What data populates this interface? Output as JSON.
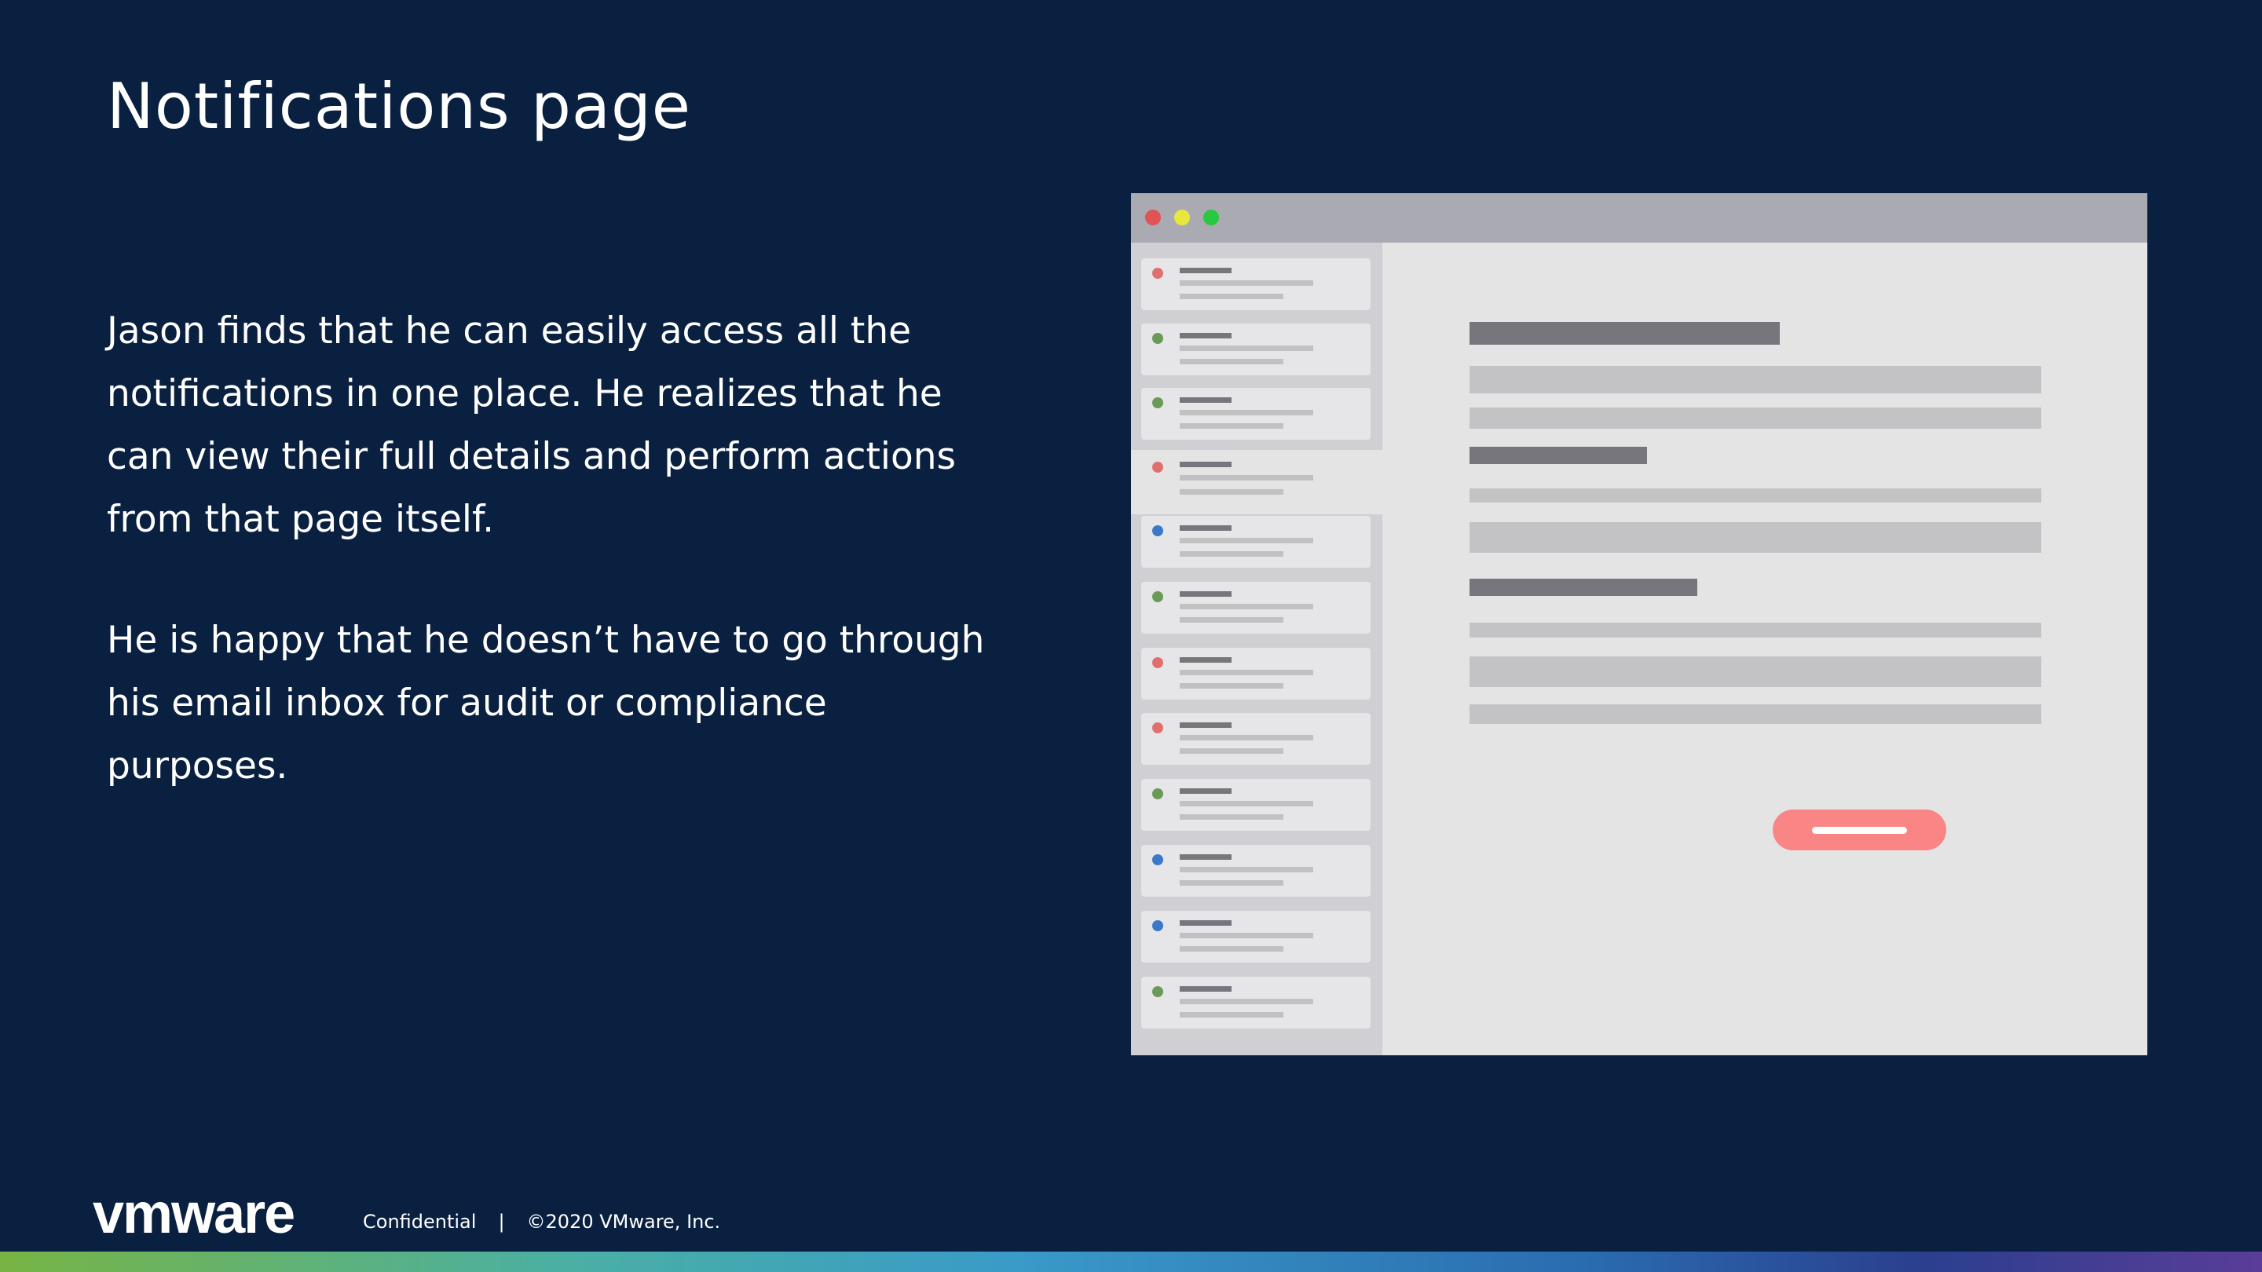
{
  "slide": {
    "title": "Notifications page",
    "paragraphs": [
      "Jason finds that he can easily access all the notifications in one place. He realizes that he can view their full details and perform actions from that page itself.",
      "He is happy that he doesn’t have to go through his email inbox for audit or compliance purposes."
    ]
  },
  "mockup": {
    "window_controls": [
      {
        "name": "close",
        "color": "#e05454"
      },
      {
        "name": "minimize",
        "color": "#e8e83c"
      },
      {
        "name": "maximize",
        "color": "#28c840"
      }
    ],
    "notification_status_colors": [
      "#e07070",
      "#6a9a58",
      "#6a9a58",
      "#e07070",
      "#3a78c8",
      "#6a9a58",
      "#e07070",
      "#e07070",
      "#6a9a58",
      "#3a78c8",
      "#3a78c8",
      "#6a9a58"
    ],
    "selected_index": 3,
    "action_button_color": "#f98685"
  },
  "footer": {
    "logo": "vmware",
    "confidential": "Confidential",
    "separator": "|",
    "copyright": "©2020 VMware, Inc."
  },
  "theme": {
    "background": "#0a2040",
    "text": "#ffffff"
  }
}
